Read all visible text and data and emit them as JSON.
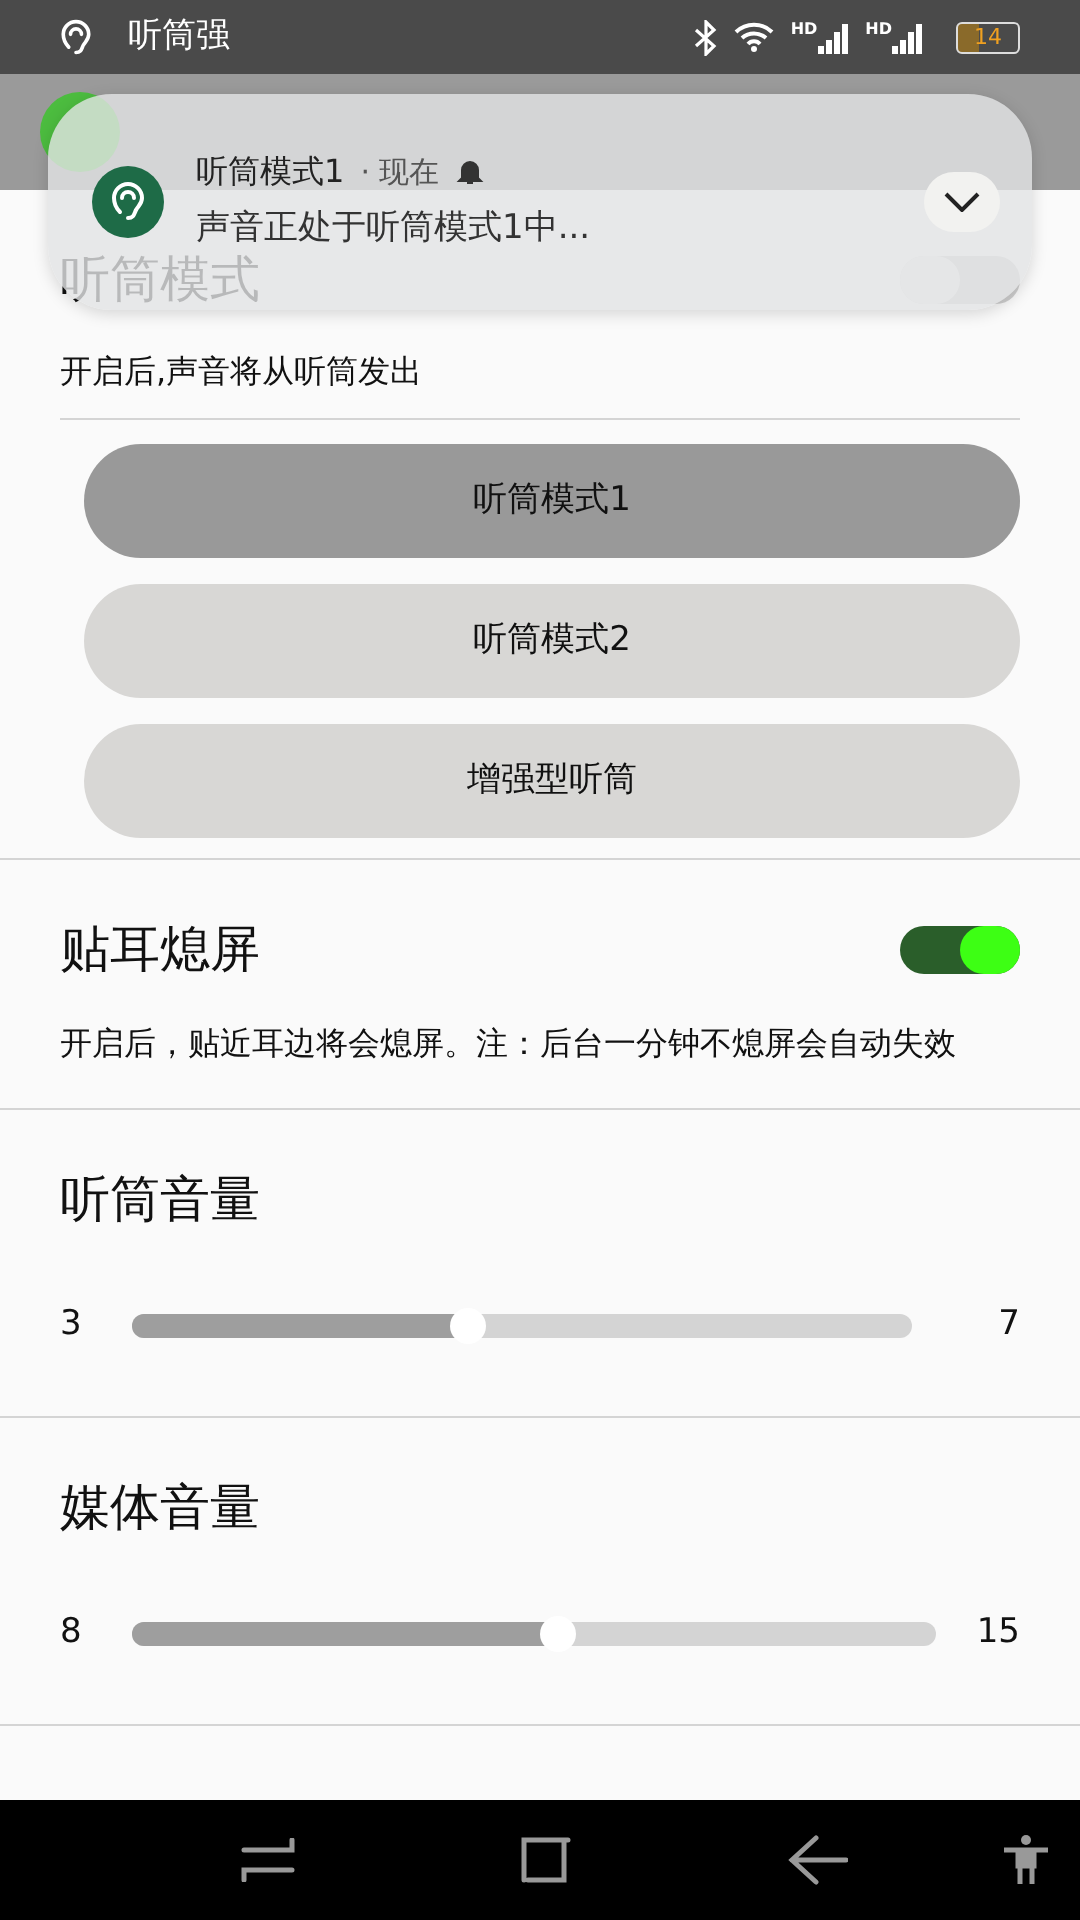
{
  "status_bar": {
    "app_title": "听筒强",
    "signals": [
      {
        "label": "HD"
      },
      {
        "label": "HD"
      }
    ],
    "battery": "14"
  },
  "notification": {
    "title": "听筒模式1",
    "time": "· 现在",
    "text": "声音正处于听筒模式1中..."
  },
  "sections": [
    {
      "kind": "modes",
      "title": "听筒模式",
      "on": false,
      "description": "开启后,声音将从听筒发出",
      "modes": [
        {
          "label": "听筒模式1",
          "selected": true
        },
        {
          "label": "听筒模式2",
          "selected": false
        },
        {
          "label": "增强型听筒",
          "selected": false
        }
      ]
    },
    {
      "kind": "toggle",
      "title": "贴耳熄屏",
      "on": true,
      "description": "开启后，贴近耳边将会熄屏。注：后台一分钟不熄屏会自动失效"
    },
    {
      "kind": "slider",
      "title": "听筒音量",
      "min": "3",
      "max": "7",
      "level": 0.43
    },
    {
      "kind": "slider",
      "title": "媒体音量",
      "min": "8",
      "max": "15",
      "level": 0.53
    }
  ]
}
